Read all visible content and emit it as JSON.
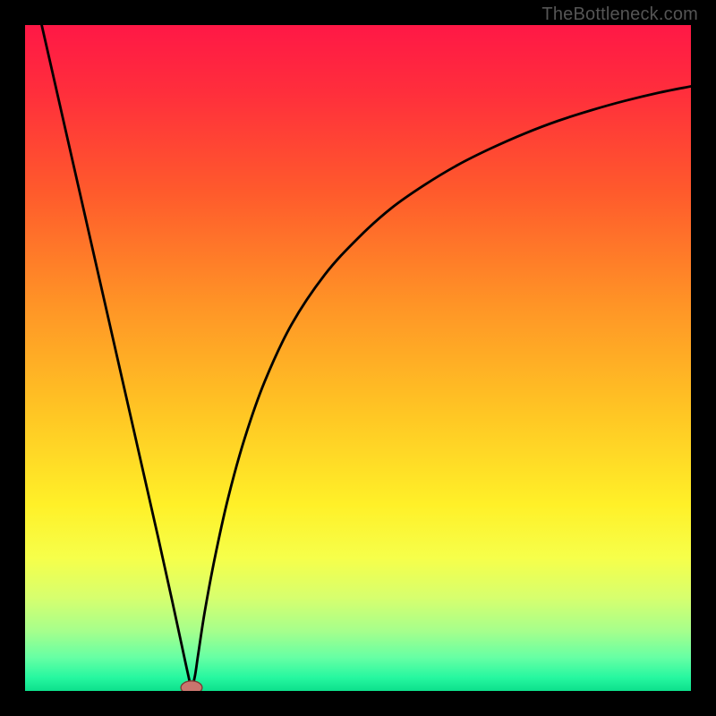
{
  "watermark": "TheBottleneck.com",
  "chart_data": {
    "type": "line",
    "title": "",
    "xlabel": "",
    "ylabel": "",
    "xlim": [
      0,
      100
    ],
    "ylim": [
      0,
      100
    ],
    "grid": false,
    "gradient_stops": [
      {
        "offset": 0.0,
        "color": "#ff1846"
      },
      {
        "offset": 0.1,
        "color": "#ff2e3c"
      },
      {
        "offset": 0.25,
        "color": "#ff5a2c"
      },
      {
        "offset": 0.42,
        "color": "#ff9426"
      },
      {
        "offset": 0.58,
        "color": "#ffc524"
      },
      {
        "offset": 0.72,
        "color": "#fff028"
      },
      {
        "offset": 0.8,
        "color": "#f6ff4a"
      },
      {
        "offset": 0.86,
        "color": "#d7ff6e"
      },
      {
        "offset": 0.91,
        "color": "#a6ff8c"
      },
      {
        "offset": 0.95,
        "color": "#66ffa4"
      },
      {
        "offset": 0.98,
        "color": "#26f7a0"
      },
      {
        "offset": 1.0,
        "color": "#0de08c"
      }
    ],
    "marker": {
      "x": 25.0,
      "y": 0.5,
      "shape": "ellipse",
      "rx": 1.6,
      "ry": 1.0,
      "fill": "#c9756e",
      "stroke": "#7a3a34"
    },
    "series": [
      {
        "name": "curve",
        "color": "#000000",
        "stroke_width": 2,
        "x": [
          2.5,
          5,
          7.5,
          10,
          12.5,
          15,
          17.5,
          20,
          22.1,
          23.5,
          24.5,
          25,
          25.5,
          26,
          27,
          28.5,
          30.5,
          33,
          36,
          40,
          45,
          50,
          55,
          60,
          65,
          70,
          75,
          80,
          85,
          90,
          95,
          100
        ],
        "y": [
          100,
          89,
          78,
          67,
          56,
          45,
          34,
          23,
          13.5,
          7,
          2.4,
          0.5,
          2.2,
          5.5,
          12,
          20,
          29,
          38,
          46.5,
          55,
          62.5,
          68,
          72.5,
          76,
          79,
          81.5,
          83.7,
          85.6,
          87.2,
          88.6,
          89.8,
          90.8
        ]
      }
    ]
  }
}
